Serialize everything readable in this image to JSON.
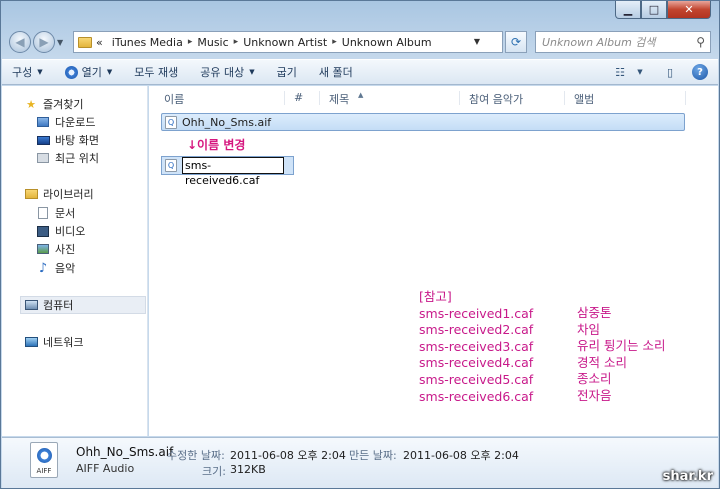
{
  "window": {
    "caption": {
      "minimize": "▁",
      "maximize": "□",
      "close": "✕"
    }
  },
  "nav": {
    "back_glyph": "◀",
    "forward_glyph": "▶",
    "drop_glyph": "▼",
    "breadcrumb_lead": "«",
    "breadcrumb": [
      "iTunes Media",
      "Music",
      "Unknown Artist",
      "Unknown Album"
    ],
    "crumb_sep": "▸",
    "address_drop": "▼",
    "refresh_glyph": "⟳",
    "search_placeholder": "Unknown Album 검색",
    "search_glyph": "⚲"
  },
  "toolbar": {
    "organize": "구성",
    "open": "열기",
    "play_all": "모두 재생",
    "share": "공유 대상",
    "burn": "굽기",
    "new_folder": "새 폴더",
    "arrow": "▼",
    "view_glyph": "☷",
    "pane_glyph": "▯",
    "help": "?"
  },
  "sidebar": {
    "favorites": "즐겨찾기",
    "downloads": "다운로드",
    "desktop": "바탕 화면",
    "recent": "최근 위치",
    "libraries": "라이브러리",
    "documents": "문서",
    "videos": "비디오",
    "pictures": "사진",
    "music": "음악",
    "computer": "컴퓨터",
    "network": "네트워크"
  },
  "columns": {
    "name": "이름",
    "number": "#",
    "title": "제목",
    "artists": "참여 음악가",
    "album": "앨범",
    "sort_glyph": "▲"
  },
  "files": {
    "original": "Ohh_No_Sms.aif",
    "rename_hint": "↓이름 변경",
    "rename_value": "sms-received6.caf"
  },
  "note": {
    "header": "[참고]",
    "rows": [
      {
        "file": "sms-received1.caf",
        "sound": "삼중톤"
      },
      {
        "file": "sms-received2.caf",
        "sound": "차임"
      },
      {
        "file": "sms-received3.caf",
        "sound": "유리 튕기는 소리"
      },
      {
        "file": "sms-received4.caf",
        "sound": "경적 소리"
      },
      {
        "file": "sms-received5.caf",
        "sound": "종소리"
      },
      {
        "file": "sms-received6.caf",
        "sound": "전자음"
      }
    ]
  },
  "details": {
    "icon_label": "AIFF",
    "name": "Ohh_No_Sms.aif",
    "type": "AIFF Audio",
    "modified_label": "수정한 날짜:",
    "modified_value": "2011-06-08 오후 2:04",
    "created_label": "만든 날짜:",
    "created_value": "2011-06-08 오후 2:04",
    "size_label": "크기:",
    "size_value": "312KB"
  },
  "watermark": "shar.kr",
  "colors": {
    "accent_text": "#c8198a",
    "selection": "#c4ddf6"
  }
}
